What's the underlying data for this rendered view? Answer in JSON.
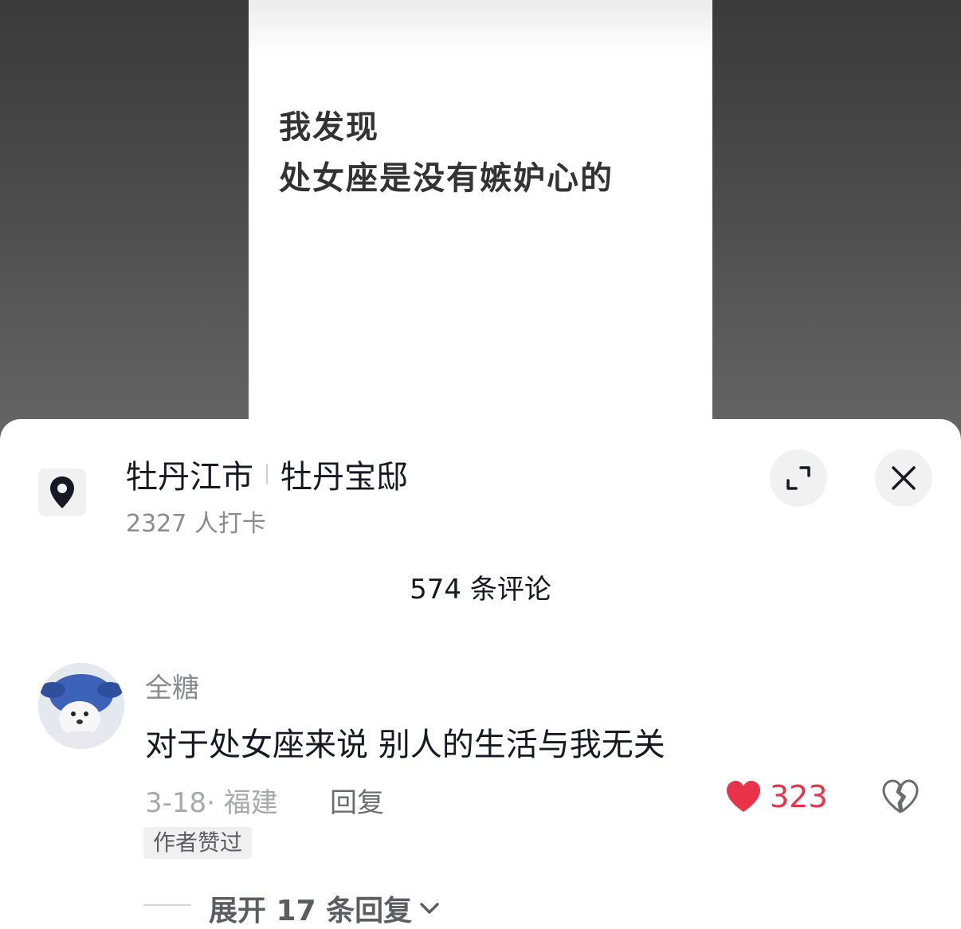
{
  "video": {
    "lines": [
      "我发现",
      "处女座是没有嫉妒心的"
    ]
  },
  "location": {
    "city": "牡丹江市",
    "place": "牡丹宝邸",
    "checkins": "2327 人打卡",
    "icon": "location-pin-icon"
  },
  "header": {
    "comment_count": "574 条评论"
  },
  "comment": {
    "username": "全糖",
    "text": "对于处女座来说 别人的生活与我无关",
    "meta": "3-18· 福建",
    "reply_label": "回复",
    "likes": "323",
    "author_badge": "作者赞过",
    "expand_label": "展开 17 条回复"
  },
  "colors": {
    "like": "#e8334a",
    "text_primary": "#161823",
    "text_secondary": "#8a8b91"
  }
}
